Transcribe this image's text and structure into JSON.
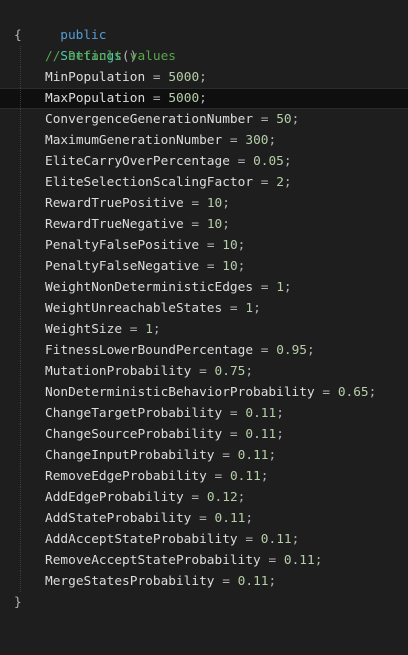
{
  "editor": {
    "signature": {
      "keyword": "public",
      "name": "Settings",
      "parens": "()"
    },
    "open_brace": "{",
    "close_brace": "}",
    "comment": "// Default values",
    "assignments": [
      {
        "name": "MinPopulation",
        "value": "5000"
      },
      {
        "name": "MaxPopulation",
        "value": "5000",
        "current": true
      },
      {
        "name": "ConvergenceGenerationNumber",
        "value": "50"
      },
      {
        "name": "MaximumGenerationNumber",
        "value": "300"
      },
      {
        "name": "EliteCarryOverPercentage",
        "value": "0.05"
      },
      {
        "name": "EliteSelectionScalingFactor",
        "value": "2"
      },
      {
        "name": "RewardTruePositive",
        "value": "10"
      },
      {
        "name": "RewardTrueNegative",
        "value": "10"
      },
      {
        "name": "PenaltyFalsePositive",
        "value": "10"
      },
      {
        "name": "PenaltyFalseNegative",
        "value": "10"
      },
      {
        "name": "WeightNonDeterministicEdges",
        "value": "1"
      },
      {
        "name": "WeightUnreachableStates",
        "value": "1"
      },
      {
        "name": "WeightSize",
        "value": "1"
      },
      {
        "name": "FitnessLowerBoundPercentage",
        "value": "0.95"
      },
      {
        "name": "MutationProbability",
        "value": "0.75"
      },
      {
        "name": "NonDeterministicBehaviorProbability",
        "value": "0.65"
      },
      {
        "name": "ChangeTargetProbability",
        "value": "0.11"
      },
      {
        "name": "ChangeSourceProbability",
        "value": "0.11"
      },
      {
        "name": "ChangeInputProbability",
        "value": "0.11"
      },
      {
        "name": "RemoveEdgeProbability",
        "value": "0.11"
      },
      {
        "name": "AddEdgeProbability",
        "value": "0.12"
      },
      {
        "name": "AddStateProbability",
        "value": "0.11"
      },
      {
        "name": "AddAcceptStateProbability",
        "value": "0.11"
      },
      {
        "name": "RemoveAcceptStateProbability",
        "value": "0.11"
      },
      {
        "name": "MergeStatesProbability",
        "value": "0.11"
      }
    ],
    "operator": "=",
    "terminator": ";",
    "colors": {
      "keyword": "#569cd6",
      "type_name": "#4ec9b0",
      "comment": "#57a64a",
      "number": "#b5cea8",
      "identifier": "#dcdcdc",
      "background": "#1e1e1e"
    }
  }
}
